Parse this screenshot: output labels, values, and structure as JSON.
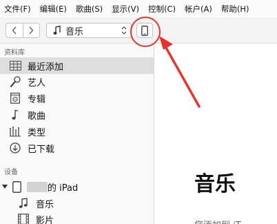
{
  "menu": [
    {
      "label": "文件(F)"
    },
    {
      "label": "编辑(E)"
    },
    {
      "label": "歌曲(S)"
    },
    {
      "label": "显示(V)"
    },
    {
      "label": "控制(C)"
    },
    {
      "label": "帐户(A)"
    },
    {
      "label": "帮助(H)"
    }
  ],
  "toolbar": {
    "back_icon": "chevron-left-icon",
    "forward_icon": "chevron-right-icon",
    "media_selector": {
      "icon": "music-note-icon",
      "value": "音乐"
    },
    "device_button_icon": "iphone-icon"
  },
  "sidebar": {
    "library_heading": "资料库",
    "library_items": [
      {
        "label": "最近添加",
        "icon": "grid-icon",
        "selected": true
      },
      {
        "label": "艺人",
        "icon": "microphone-icon"
      },
      {
        "label": "专辑",
        "icon": "album-icon"
      },
      {
        "label": "歌曲",
        "icon": "music-note-icon"
      },
      {
        "label": "类型",
        "icon": "genres-icon"
      },
      {
        "label": "已下载",
        "icon": "download-icon"
      }
    ],
    "devices_heading": "设备",
    "device": {
      "name_suffix": "的 iPad",
      "icon": "ipad-icon"
    },
    "device_items": [
      {
        "label": "音乐",
        "icon": "music-note-icon"
      },
      {
        "label": "影片",
        "icon": "film-icon"
      }
    ]
  },
  "main": {
    "title": "音乐",
    "subtitle": "您添加到 iT"
  },
  "annotation": {
    "color": "#e8332a"
  }
}
